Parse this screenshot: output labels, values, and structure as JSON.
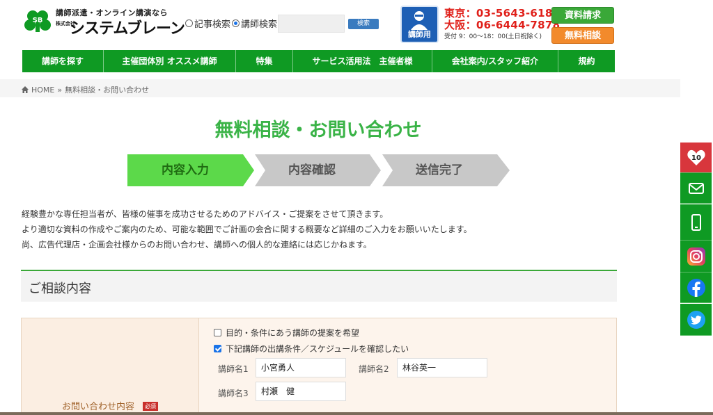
{
  "header": {
    "logo_tagline": "講師派遣・オンライン講演なら",
    "logo_company_prefix": "株式会社",
    "logo_name": "システムブレーン",
    "search": {
      "option_articles": "記事検索",
      "option_lecturers": "講師検索",
      "selected": "講師検索",
      "input_value": "",
      "button_label": "検索"
    },
    "lecturer_button_label": "講師用",
    "phone_tokyo": "東京：03-5643-6180",
    "phone_osaka": "大阪：06-6444-7878",
    "hours": "受付 9：00〜18：00(土日祝除く)",
    "request_docs_label": "資料請求",
    "free_consult_label": "無料相談"
  },
  "nav": {
    "items": [
      {
        "label": "講師を探す"
      },
      {
        "label": "主催団体別 オススメ講師"
      },
      {
        "label": "特集"
      },
      {
        "label": "サービス活用法　主催者様"
      },
      {
        "label": "会社案内/スタッフ紹介"
      },
      {
        "label": "規約"
      }
    ]
  },
  "breadcrumb": {
    "home": "HOME",
    "separator": "»",
    "current": "無料相談・お問い合わせ"
  },
  "page_title": "無料相談・お問い合わせ",
  "steps": [
    {
      "label": "内容入力",
      "active": true
    },
    {
      "label": "内容確認",
      "active": false
    },
    {
      "label": "送信完了",
      "active": false
    }
  ],
  "intro": {
    "line1": "経験豊かな専任担当者が、皆様の催事を成功させるためのアドバイス・ご提案をさせて頂きます。",
    "line2": "より適切な資料の作成やご案内のため、可能な範囲でご計画の会合に関する概要など詳細のご入力をお願いいたします。",
    "line3": "尚、広告代理店・企画会社様からのお問い合わせ、講師への個人的な連絡には応じかねます。"
  },
  "section": {
    "title": "ご相談内容"
  },
  "form": {
    "label": "お問い合わせ内容",
    "required_badge": "必須",
    "checkbox1_label": "目的・条件にあう講師の提案を希望",
    "checkbox1_checked": false,
    "checkbox2_label": "下記講師の出講条件／スケジュールを確認したい",
    "checkbox2_checked": true,
    "lecturer1_label": "講師名1",
    "lecturer1_value": "小宮勇人",
    "lecturer2_label": "講師名2",
    "lecturer2_value": "林谷英一",
    "lecturer3_label": "講師名3",
    "lecturer3_value": "村瀬　健"
  },
  "sidebar": {
    "like_count": "10",
    "icons": [
      "heart-icon",
      "mail-icon",
      "smartphone-icon",
      "instagram-icon",
      "facebook-icon",
      "twitter-icon"
    ]
  },
  "colors": {
    "brand_green": "#0f9a23",
    "title_green": "#3ab347",
    "step_active": "#5cd94a",
    "step_inactive": "#c8c8c8",
    "phone_red": "#e0201a",
    "orange": "#f28a2c",
    "heart_red": "#d8363c"
  }
}
